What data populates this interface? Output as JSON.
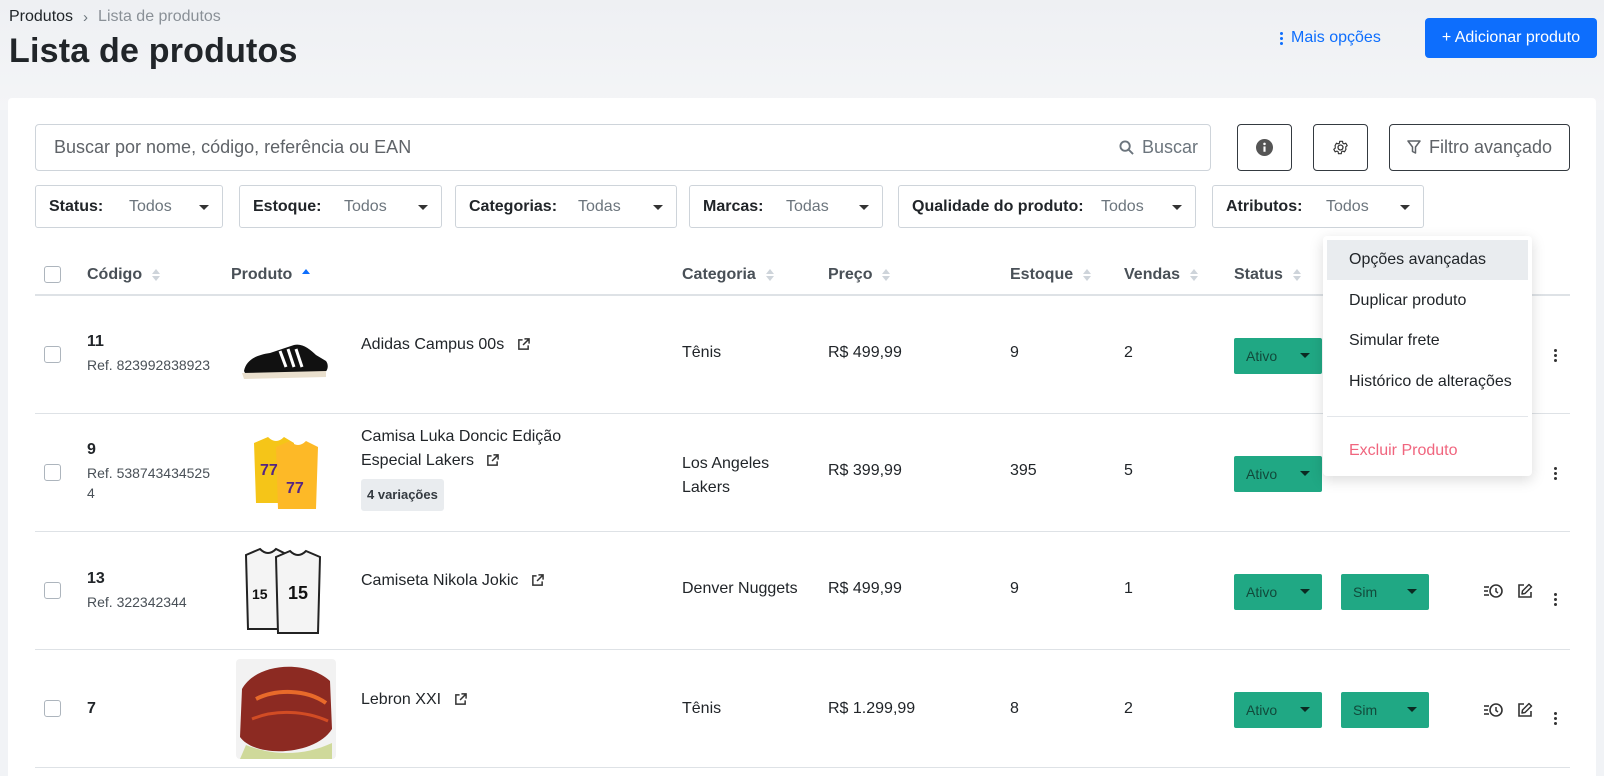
{
  "breadcrumb": {
    "root": "Produtos",
    "separator": "›",
    "current": "Lista de produtos"
  },
  "page": {
    "title": "Lista de produtos"
  },
  "header": {
    "more_options": "Mais opções",
    "add_button": "+ Adicionar produto"
  },
  "search": {
    "placeholder": "Buscar por nome, código, referência ou EAN",
    "button": "Buscar"
  },
  "toolbar": {
    "advanced_filter": "Filtro avançado"
  },
  "filters": [
    {
      "label": "Status:",
      "value": "Todos"
    },
    {
      "label": "Estoque:",
      "value": "Todos"
    },
    {
      "label": "Categorias:",
      "value": "Todas"
    },
    {
      "label": "Marcas:",
      "value": "Todas"
    },
    {
      "label": "Qualidade do produto:",
      "value": "Todos"
    },
    {
      "label": "Atributos:",
      "value": "Todos"
    }
  ],
  "table": {
    "columns": [
      "Código",
      "Produto",
      "Categoria",
      "Preço",
      "Estoque",
      "Vendas",
      "Status"
    ],
    "rows": [
      {
        "code": "11",
        "ref": "Ref. 823992838923",
        "name": "Adidas Campus 00s",
        "category": "Tênis",
        "price": "R$ 499,99",
        "stock": "9",
        "sales": "2",
        "status": "Ativo",
        "flag": ""
      },
      {
        "code": "9",
        "ref": "Ref. 5387434345254",
        "name": "Camisa Luka Doncic Edição Especial Lakers",
        "variations": "4 variações",
        "category": "Los Angeles Lakers",
        "price": "R$ 399,99",
        "stock": "395",
        "sales": "5",
        "status": "Ativo",
        "flag": ""
      },
      {
        "code": "13",
        "ref": "Ref. 322342344",
        "name": "Camiseta Nikola Jokic",
        "category": "Denver Nuggets",
        "price": "R$ 499,99",
        "stock": "9",
        "sales": "1",
        "status": "Ativo",
        "flag": "Sim"
      },
      {
        "code": "7",
        "ref": "",
        "name": "Lebron XXI",
        "category": "Tênis",
        "price": "R$ 1.299,99",
        "stock": "8",
        "sales": "2",
        "status": "Ativo",
        "flag": "Sim"
      }
    ]
  },
  "row_menu": {
    "items": [
      "Opções avançadas",
      "Duplicar produto",
      "Simular frete",
      "Histórico de alterações"
    ],
    "danger": "Excluir Produto"
  },
  "colors": {
    "primary": "#0d6efd",
    "success": "#20a884",
    "danger": "#f0657e"
  },
  "icons": [
    "chevron-right-icon",
    "kebab-icon",
    "search-icon",
    "info-icon",
    "gear-icon",
    "filter-icon",
    "sort-icon",
    "external-link-icon",
    "history-icon",
    "edit-icon",
    "caret-down-icon"
  ]
}
